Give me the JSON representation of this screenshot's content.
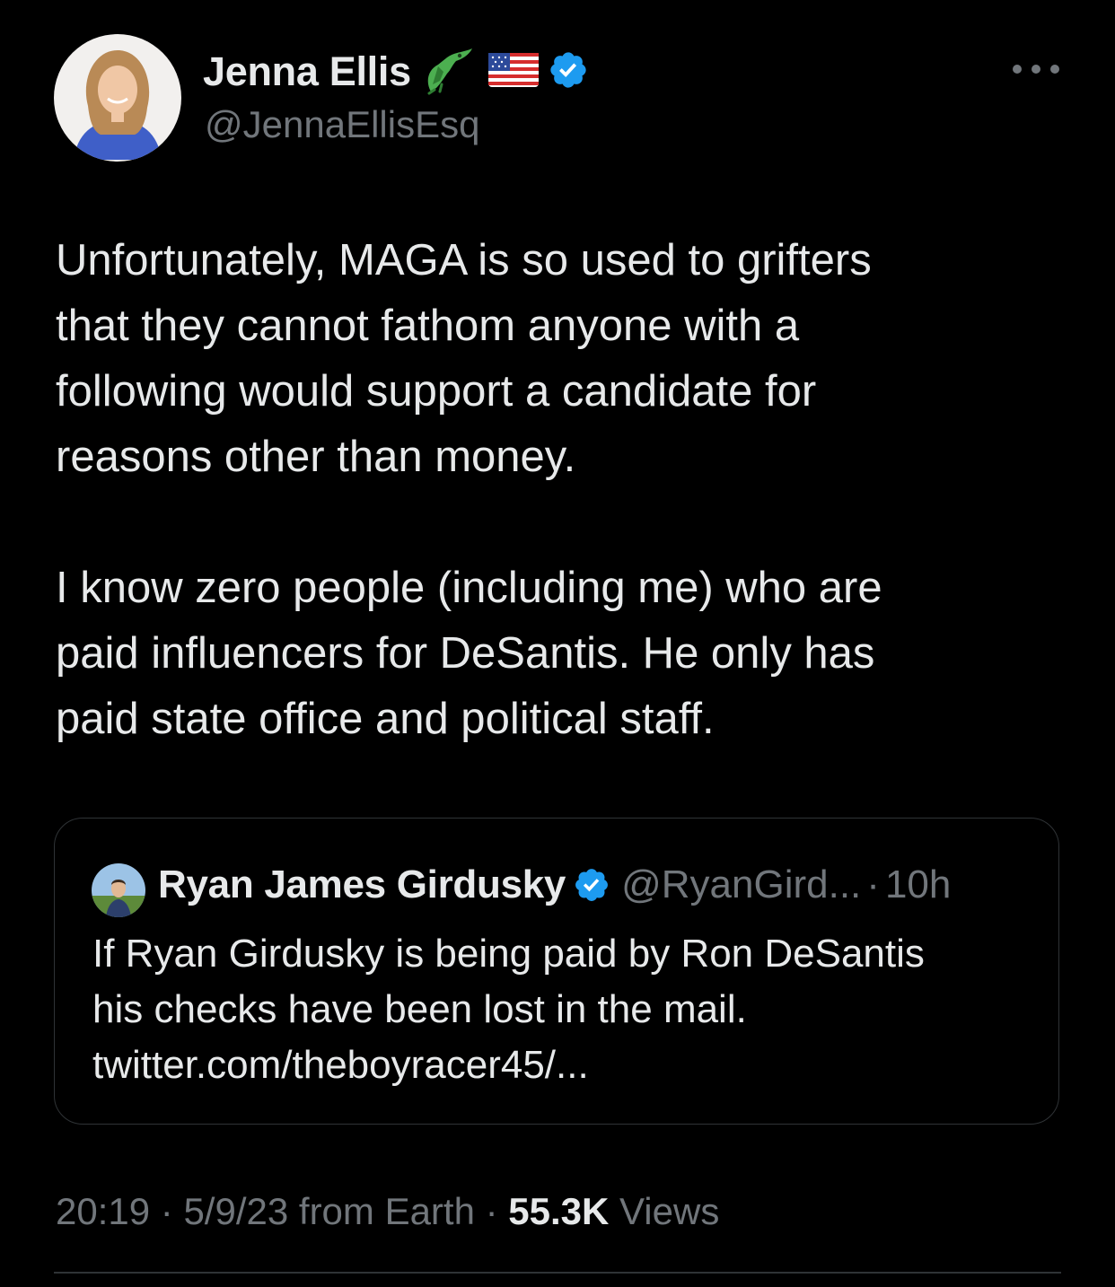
{
  "author": {
    "display_name": "Jenna Ellis",
    "handle": "@JennaEllisEsq",
    "name_emoji": [
      "alligator-emoji",
      "us-flag-emoji"
    ],
    "verified": true
  },
  "tweet": {
    "paragraphs": [
      [
        "Unfortunately, MAGA is so used to grifters",
        "that they cannot fathom anyone with a",
        "following would support a candidate for",
        "reasons other than money."
      ],
      [
        "I know zero people (including me) who are",
        "paid influencers for DeSantis. He only has",
        "paid state office and political staff."
      ]
    ]
  },
  "quoted_tweet": {
    "display_name": "Ryan James Girdusky",
    "verified": true,
    "handle": "@RyanGird...",
    "separator": "·",
    "time": "10h",
    "lines": [
      "If Ryan Girdusky is being paid by Ron DeSantis",
      "his checks have been lost in the mail.",
      "twitter.com/theboyracer45/..."
    ]
  },
  "meta": {
    "time": "20:19",
    "sep1": "·",
    "date_source": "5/9/23 from Earth",
    "sep2": "·",
    "views_count": "55.3K",
    "views_label": "Views"
  },
  "colors": {
    "background": "#000000",
    "text_primary": "#e7e9ea",
    "text_secondary": "#71767b",
    "verified_blue": "#1d9bf0",
    "border": "#2f3336"
  }
}
